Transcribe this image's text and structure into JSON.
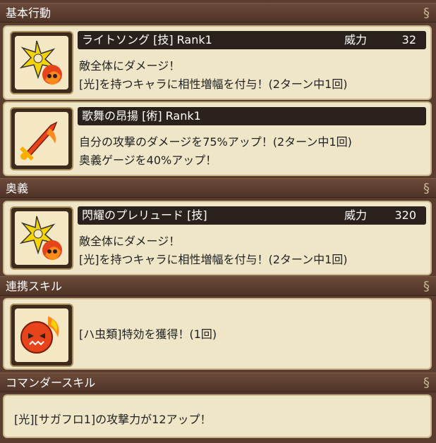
{
  "sections": {
    "basic_action": "基本行動",
    "ougi": "奥義",
    "renkei": "連携スキル",
    "commander": "コマンダースキル"
  },
  "skills": {
    "light_song": {
      "title": "ライトソング [技]  Rank1",
      "power_label": "威力",
      "power_value": "32",
      "line1": "敵全体にダメージ！",
      "line2": "[光]を持つキャラに相性増幅を付与！(2ターン中1回)"
    },
    "kabu": {
      "title": "歌舞の昂揚 [術]  Rank1",
      "line1": "自分の攻撃のダメージを75%アップ！(2ターン中1回)",
      "line2": "奥義ゲージを40%アップ！"
    },
    "prelude": {
      "title": "閃耀のプレリュード [技]",
      "power_label": "威力",
      "power_value": "320",
      "line1": "敵全体にダメージ！",
      "line2": "[光]を持つキャラに相性増幅を付与！(2ターン中1回)"
    },
    "renkei": {
      "line1": "[ハ虫類]特効を獲得！(1回)"
    },
    "commander": {
      "line1": "[光][サガフロ1]の攻撃力が12アップ！"
    }
  },
  "icons": {
    "light_song": "shuriken-fire-icon",
    "kabu": "flaming-sword-icon",
    "prelude": "shuriken-fire-icon",
    "renkei": "reptile-flame-icon"
  }
}
